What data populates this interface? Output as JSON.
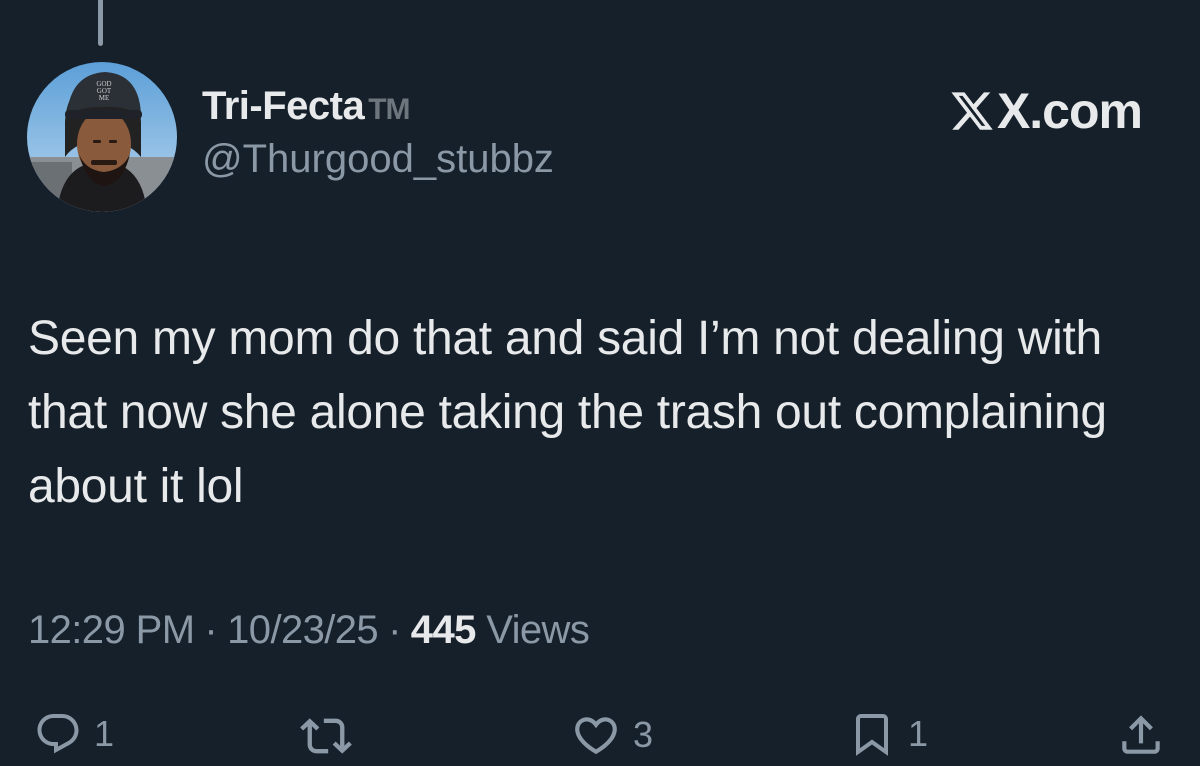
{
  "tweet": {
    "display_name": "Tri-Fecta",
    "name_suffix": "TM",
    "handle": "@Thurgood_stubbz",
    "brand": "X.com",
    "text": "Seen my mom do that and said I’m not dealing with that now she alone taking the trash out complaining about it lol",
    "time": "12:29 PM",
    "date": "10/23/25",
    "separator": "·",
    "views_count": "445",
    "views_label": "Views"
  },
  "actions": {
    "reply_count": "1",
    "like_count": "3",
    "bookmark_count": "1"
  },
  "icons": {
    "reply": "reply-icon",
    "retweet": "retweet-icon",
    "like": "heart-icon",
    "bookmark": "bookmark-icon",
    "share": "share-icon"
  },
  "colors": {
    "background": "#15202b",
    "primary_text": "#e7e9ea",
    "secondary_text": "#8b98a5"
  }
}
